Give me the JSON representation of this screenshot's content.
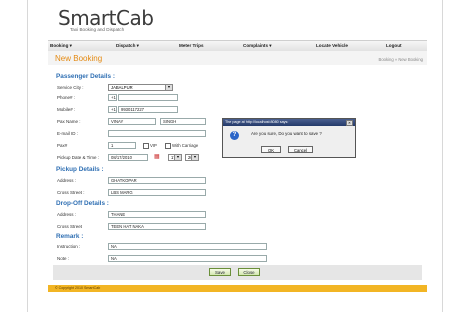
{
  "brand": {
    "logo": "SmartCab",
    "tagline": "Taxi Booking and Dispatch"
  },
  "nav": [
    {
      "label": "Booking  ▾"
    },
    {
      "label": "Dispatch  ▾"
    },
    {
      "label": "Meter Trips"
    },
    {
      "label": "Complaints  ▾"
    },
    {
      "label": "Locate Vehicle"
    },
    {
      "label": "Logout"
    }
  ],
  "page": {
    "title": "New Booking",
    "breadcrumb": "Booking » New Booking"
  },
  "passenger": {
    "heading": "Passenger Details :",
    "service_city_label": "Service City :",
    "service_city": "JABALPUR",
    "phone_label": "Phone# :",
    "phone_prefix": "+1",
    "phone": "",
    "mobile_label": "Mobile# :",
    "mobile_prefix": "+1",
    "mobile": "9930117227",
    "name_label": "Pax Name :",
    "first_name": "VINAY",
    "last_name": "SINGH",
    "email_label": "E-mail ID :",
    "email": "",
    "pax_label": "Pax#",
    "pax": "1",
    "vip_label": "VIP",
    "carriage_label": "With Carriage",
    "pickup_dt_label": "Pickup Date & Time :",
    "pickup_date": "08/17/2010",
    "hour": "17",
    "minute": "20"
  },
  "pickup": {
    "heading": "Pickup Details :",
    "address_label": "Address :",
    "address": "GHATKOPAR",
    "cross_label": "Cross Street :",
    "cross": "LBS MARG"
  },
  "dropoff": {
    "heading": "Drop-Off Details :",
    "address_label": "Address :",
    "address": "THANE",
    "cross_label": "Cross Street",
    "cross": "TEEN HAT NAKA"
  },
  "remark": {
    "heading": "Remark :",
    "instruction_label": "Instruction :",
    "instruction": "NA",
    "note_label": "Note :",
    "note": "NA"
  },
  "buttons": {
    "save": "Save",
    "close": "Close"
  },
  "footer": {
    "copyright": "© Copyright 2010 SmartCab"
  },
  "dialog": {
    "title": "The page at http://localhost:8080 says:",
    "message": "Are you sure, Do you want to save ?",
    "ok": "OK",
    "cancel": "Cancel",
    "close_glyph": "✕",
    "icon_glyph": "?"
  }
}
